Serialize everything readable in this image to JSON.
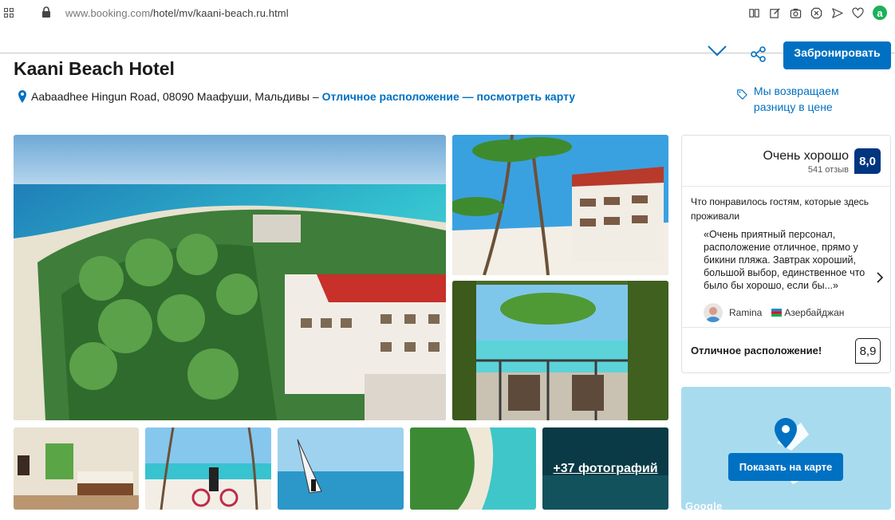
{
  "browser": {
    "url_host": "www.booking.com",
    "url_path": "/hotel/mv/kaani-beach.ru.html"
  },
  "header": {
    "reserve_label": "Забронировать"
  },
  "hotel": {
    "name": "Kaani Beach Hotel",
    "address": "Aabaadhee Hingun Road, 08090 Маафуши, Мальдивы –",
    "location_link": "Отличное расположение — посмотреть карту",
    "price_match": "Мы возвращаем разницу в цене"
  },
  "gallery": {
    "more_photos": "+37 фотографий"
  },
  "review": {
    "score_label": "Очень хорошо",
    "review_count": "541 отзыв",
    "score": "8,0",
    "liked_heading": "Что понравилось гостям, которые здесь проживали",
    "quote": "«Очень приятный персонал, расположение отличное, прямо у бикини пляжа. Завтрак хороший, большой выбор, единственное что было бы хорошо, если бы...»",
    "reviewer_name": "Ramina",
    "reviewer_country": "Азербайджан",
    "location_label": "Отличное расположение!",
    "location_score": "8,9"
  },
  "map": {
    "show_on_map": "Показать на карте",
    "provider": "Google"
  },
  "colors": {
    "brand_blue": "#0071c2",
    "score_dark": "#003580"
  }
}
